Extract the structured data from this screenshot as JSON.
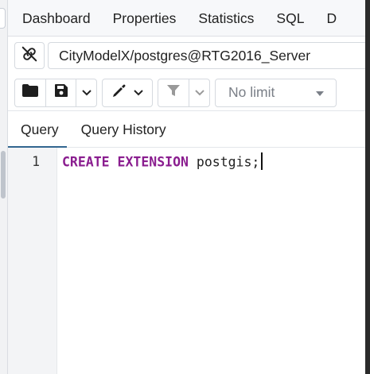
{
  "top_tabs": [
    "Dashboard",
    "Properties",
    "Statistics",
    "SQL",
    "D"
  ],
  "connection": {
    "label": "CityModelX/postgres@RTG2016_Server"
  },
  "toolbar": {
    "limit_label": "No limit"
  },
  "query_tabs": [
    "Query",
    "Query History"
  ],
  "editor": {
    "line_number": "1",
    "keyword_1": "CREATE",
    "keyword_2": "EXTENSION",
    "rest": " postgis;"
  },
  "icons": {
    "connection": "link-slash-icon",
    "open": "folder-icon",
    "save": "save-icon",
    "edit": "pen-icon",
    "filter": "filter-icon",
    "dropdown": "chevron-down-icon"
  },
  "colors": {
    "keyword": "#8a1d8f",
    "active_tab_underline": "#326690"
  }
}
